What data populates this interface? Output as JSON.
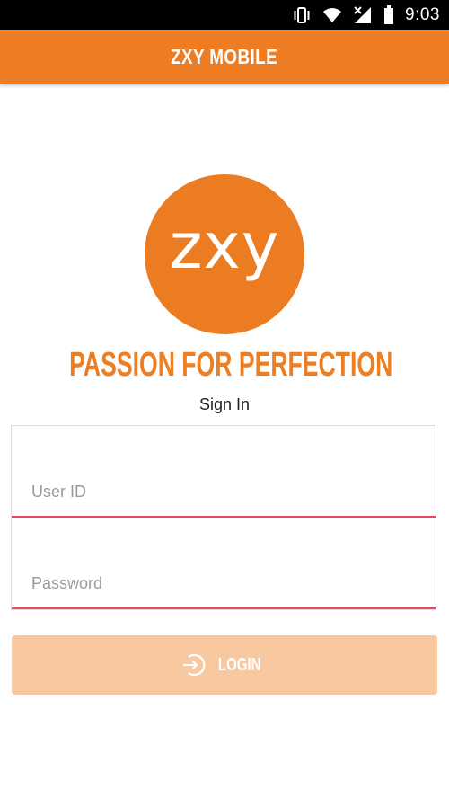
{
  "status_bar": {
    "time": "9:03",
    "icons": [
      "vibrate-icon",
      "wifi-icon",
      "signal-icon",
      "battery-icon"
    ]
  },
  "app_bar": {
    "title": "ZXY MOBILE",
    "color": "#ee7c22"
  },
  "logo": {
    "text": "zxy",
    "color": "#ec7c22"
  },
  "tagline": "PASSION FOR PERFECTION",
  "form": {
    "heading": "Sign In",
    "user_id": {
      "value": "",
      "placeholder": "User ID"
    },
    "password": {
      "value": "",
      "placeholder": "Password"
    },
    "underline_color": "#e9485a"
  },
  "login_button": {
    "label": "LOGIN",
    "icon": "login-icon",
    "color": "#f8c8a0"
  }
}
